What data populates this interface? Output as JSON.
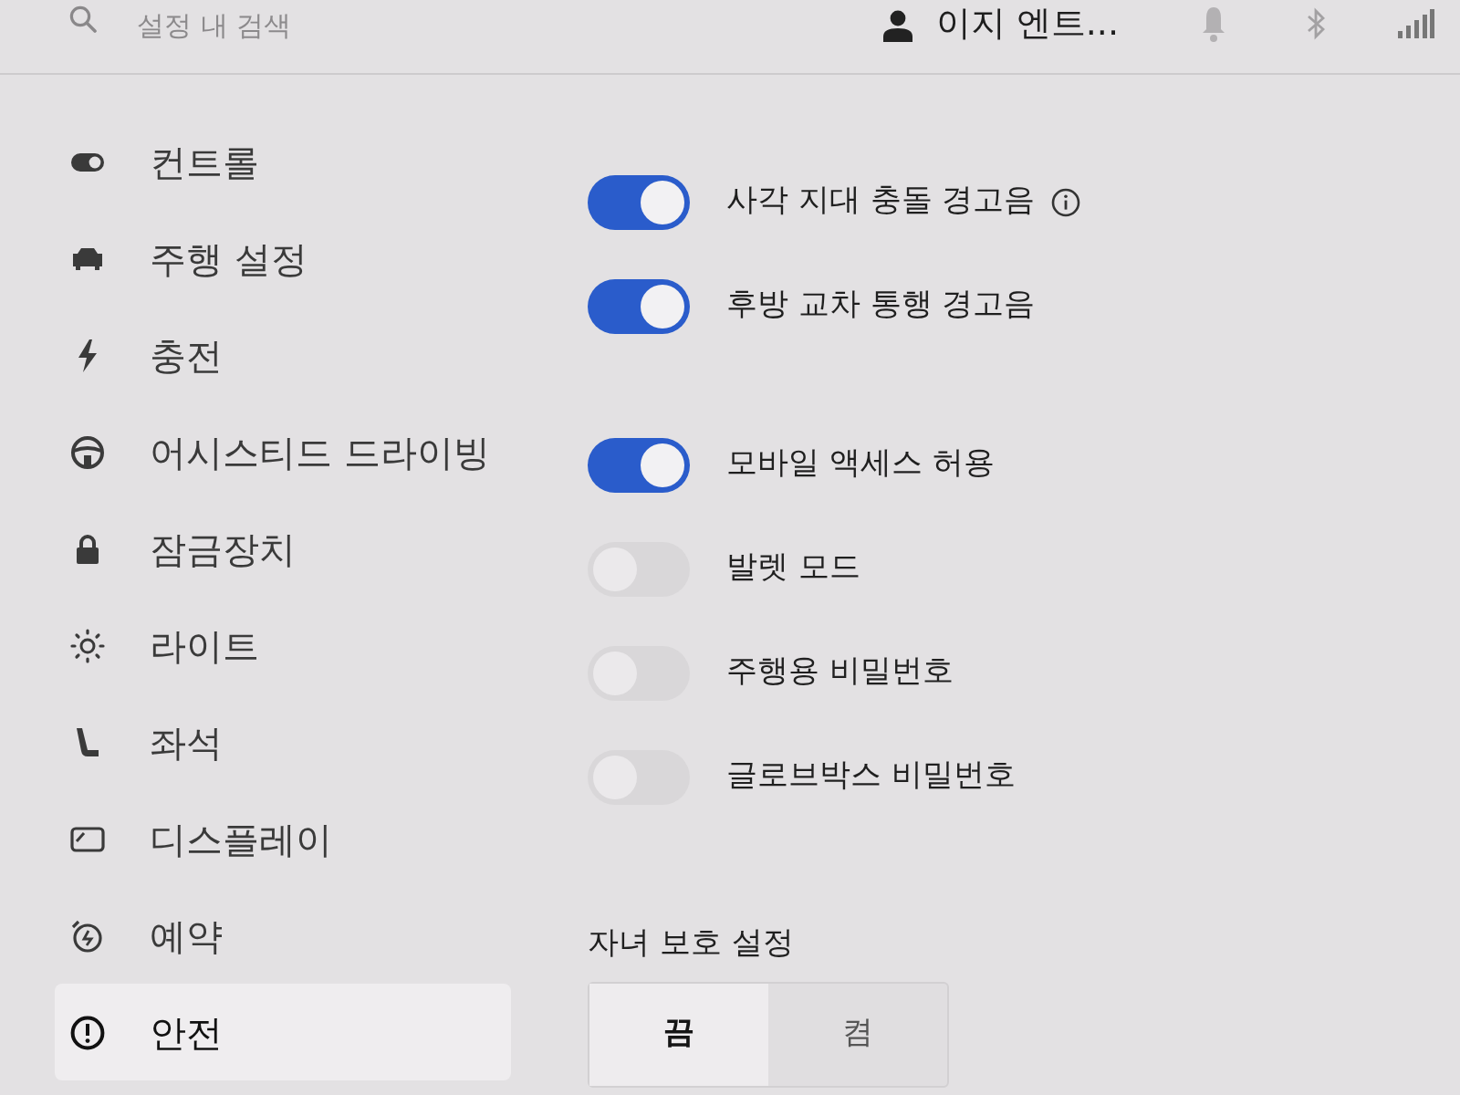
{
  "top_bar": {
    "search": {
      "placeholder": "설정 내 검색"
    },
    "profile": {
      "name": "이지 엔트..."
    }
  },
  "sidebar": {
    "items": [
      {
        "label": "컨트롤",
        "selected": false
      },
      {
        "label": "주행 설정",
        "selected": false
      },
      {
        "label": "충전",
        "selected": false
      },
      {
        "label": "어시스티드 드라이빙",
        "selected": false
      },
      {
        "label": "잠금장치",
        "selected": false
      },
      {
        "label": "라이트",
        "selected": false
      },
      {
        "label": "좌석",
        "selected": false
      },
      {
        "label": "디스플레이",
        "selected": false
      },
      {
        "label": "예약",
        "selected": false
      },
      {
        "label": "안전",
        "selected": true
      }
    ]
  },
  "toggle_sections": [
    {
      "toggles": [
        {
          "label": "사각 지대 충돌 경고음",
          "on": true,
          "info": true
        },
        {
          "label": "후방 교차 통행 경고음",
          "on": true,
          "info": false
        }
      ]
    },
    {
      "toggles": [
        {
          "label": "모바일 액세스 허용",
          "on": true,
          "info": false
        },
        {
          "label": "발렛 모드",
          "on": false,
          "info": false
        },
        {
          "label": "주행용 비밀번호",
          "on": false,
          "info": false
        },
        {
          "label": "글로브박스 비밀번호",
          "on": false,
          "info": false
        }
      ]
    }
  ],
  "child_lock": {
    "label": "자녀 보호 설정",
    "options": [
      {
        "label": "끔",
        "selected": true
      },
      {
        "label": "켬",
        "selected": false
      }
    ]
  }
}
